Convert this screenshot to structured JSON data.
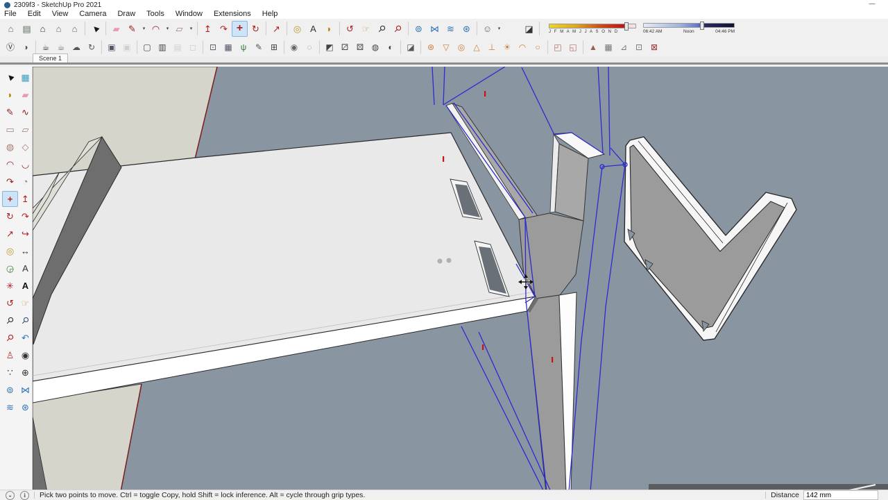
{
  "window": {
    "title": "2309f3 - SketchUp Pro 2021",
    "minimize_glyph": "—"
  },
  "menu": {
    "items": [
      "File",
      "Edit",
      "View",
      "Camera",
      "Draw",
      "Tools",
      "Window",
      "Extensions",
      "Help"
    ]
  },
  "toolbar_top": {
    "icons": [
      {
        "n": "view-house-iso-icon",
        "g": "⌂",
        "c": "#5f6e5f"
      },
      {
        "n": "view-box-icon",
        "g": "▤",
        "c": "#5f6e5f"
      },
      {
        "n": "view-home-icon",
        "g": "⌂",
        "c": "#333333"
      },
      {
        "n": "view-house-front-icon",
        "g": "⌂",
        "c": "#5f6e5f"
      },
      {
        "n": "view-house-wide-icon",
        "g": "⌂",
        "c": "#5f6e5f"
      },
      {
        "t": "sep"
      },
      {
        "n": "select-tool-icon",
        "g": "►",
        "c": "#1a1a1a",
        "rot": -135
      },
      {
        "t": "sep"
      },
      {
        "n": "eraser-tool-icon",
        "g": "▰",
        "c": "#e89ab0"
      },
      {
        "n": "line-tool-icon",
        "g": "✎",
        "c": "#8b1a1a"
      },
      {
        "n": "line-dropdown-icon",
        "t": "dd",
        "g": "▾"
      },
      {
        "n": "arc-tool-icon",
        "g": "◠",
        "c": "#8b1a1a"
      },
      {
        "n": "arc-dropdown-icon",
        "t": "dd",
        "g": "▾"
      },
      {
        "n": "rectangle-tool-icon",
        "g": "▱",
        "c": "#a08074"
      },
      {
        "n": "rectangle-dropdown-icon",
        "t": "dd",
        "g": "▾"
      },
      {
        "t": "sep"
      },
      {
        "n": "push-pull-tool-icon",
        "g": "↥",
        "c": "#b02020"
      },
      {
        "n": "follow-me-tool-icon",
        "g": "↷",
        "c": "#b02020"
      },
      {
        "n": "move-tool-icon",
        "g": "+",
        "c": "#b02020",
        "sel": true,
        "b": true
      },
      {
        "n": "rotate-tool-icon",
        "g": "↻",
        "c": "#b02020"
      },
      {
        "t": "sep"
      },
      {
        "n": "scale-tool-icon",
        "g": "↗",
        "c": "#b02020"
      },
      {
        "t": "sep"
      },
      {
        "n": "tape-measure-icon",
        "g": "◎",
        "c": "#b8962e"
      },
      {
        "n": "text-tool-icon",
        "g": "A",
        "c": "#333333"
      },
      {
        "n": "paint-bucket-icon",
        "g": "◗",
        "c": "#b8860b"
      },
      {
        "t": "sep"
      },
      {
        "n": "orbit-tool-icon",
        "g": "↺",
        "c": "#b02020"
      },
      {
        "n": "pan-tool-icon",
        "g": "☞",
        "c": "#c8a050"
      },
      {
        "n": "zoom-tool-icon",
        "g": "⚲",
        "c": "#333333",
        "rot": 45
      },
      {
        "n": "zoom-extents-icon",
        "g": "⚲",
        "c": "#b02020",
        "rot": 45
      },
      {
        "t": "sep"
      },
      {
        "n": "scan-essentials-icon",
        "g": "⊚",
        "c": "#2f74b5"
      },
      {
        "n": "trimble-scan-icon",
        "g": "⋈",
        "c": "#2f74b5"
      },
      {
        "n": "layers-blue-icon",
        "g": "≋",
        "c": "#2f74b5"
      },
      {
        "n": "mesh-blue-icon",
        "g": "⊛",
        "c": "#2f74b5"
      },
      {
        "t": "sep"
      },
      {
        "n": "account-icon",
        "g": "☺",
        "c": "#666666"
      },
      {
        "n": "account-dropdown-icon",
        "t": "dd",
        "g": "▾"
      },
      {
        "t": "gap"
      },
      {
        "n": "shadows-toggle-icon",
        "g": "◪",
        "c": "#333333"
      },
      {
        "t": "sep"
      }
    ]
  },
  "shadow_bar": {
    "months": "J F M A M J J A S O N D",
    "time_start": "06:42 AM",
    "time_mid": "Noon",
    "time_end": "04:46 PM",
    "date_stops": [
      "#ead823 0%",
      "#e0a81e 30%",
      "#cc4418 62%",
      "#c01616 87%",
      "#f0d9d9 88%",
      "#f3e4e4 100%"
    ],
    "time_stops": [
      "#e4ebf4 0%",
      "#9fb4dd 40%",
      "#6474cc 60%",
      "#262a66 68%",
      "#10122e 100%"
    ]
  },
  "toolbar_vray": {
    "icons": [
      {
        "n": "vray-logo-icon",
        "g": "Ⓥ",
        "c": "#3a3a3a"
      },
      {
        "n": "asset-editor-icon",
        "g": "◑",
        "c": "#555555"
      },
      {
        "t": "sep"
      },
      {
        "n": "render-icon",
        "g": "☕",
        "c": "#3a3a3a"
      },
      {
        "n": "interactive-render-icon",
        "g": "☕",
        "c": "#777777"
      },
      {
        "n": "cloud-render-icon",
        "g": "☁",
        "c": "#555555"
      },
      {
        "n": "swarm-render-icon",
        "g": "↻",
        "c": "#555555"
      },
      {
        "t": "sep"
      },
      {
        "n": "viewport-render-icon",
        "g": "▣",
        "c": "#555566"
      },
      {
        "n": "viewport-render-region-icon",
        "g": "▣",
        "c": "#b5b5b5",
        "dis": true
      },
      {
        "t": "sep"
      },
      {
        "n": "frame-buffer-icon",
        "g": "▢",
        "c": "#444444"
      },
      {
        "n": "batch-render-icon",
        "g": "▥",
        "c": "#444444"
      },
      {
        "n": "image-viewer-icon",
        "g": "▤",
        "c": "#b5b5b5",
        "dis": true
      },
      {
        "n": "lock-icon",
        "g": "◻",
        "c": "#b5b5b5",
        "dis": true
      },
      {
        "t": "sep"
      },
      {
        "n": "infinite-plane-icon",
        "g": "⊡",
        "c": "#555566"
      },
      {
        "n": "displacement-icon",
        "g": "▦",
        "c": "#555566"
      },
      {
        "n": "fur-icon",
        "g": "ψ",
        "c": "#3a7a3a"
      },
      {
        "n": "clipper-icon",
        "g": "✎",
        "c": "#555555"
      },
      {
        "n": "vray-mesh-icon",
        "g": "⊞",
        "c": "#444444"
      },
      {
        "t": "sep"
      },
      {
        "n": "sphere-add-icon",
        "g": "◉",
        "c": "#666666"
      },
      {
        "n": "sphere-remove-icon",
        "g": "◌",
        "c": "#888888"
      },
      {
        "t": "sep"
      },
      {
        "n": "material-id-icon",
        "g": "◩",
        "c": "#444444"
      },
      {
        "n": "random-color-icon",
        "g": "⚂",
        "c": "#444444"
      },
      {
        "n": "multimatte-icon",
        "g": "⚄",
        "c": "#444444"
      },
      {
        "n": "checker-sphere-icon",
        "g": "◍",
        "c": "#444444"
      },
      {
        "n": "half-sphere-icon",
        "g": "◐",
        "c": "#444444"
      },
      {
        "t": "sep"
      },
      {
        "n": "cube-pick-icon",
        "g": "◪",
        "c": "#555555"
      },
      {
        "t": "sep"
      },
      {
        "n": "light-gen-icon",
        "g": "⊛",
        "c": "#c87f3e"
      },
      {
        "n": "spot-light-icon",
        "g": "▽",
        "c": "#c87f3e"
      },
      {
        "n": "omni-light-icon",
        "g": "◎",
        "c": "#c87f3e"
      },
      {
        "n": "directional-light-icon",
        "g": "△",
        "c": "#c87f3e"
      },
      {
        "n": "ies-light-icon",
        "g": "⊥",
        "c": "#c87f3e"
      },
      {
        "n": "sun-light-icon",
        "g": "☀",
        "c": "#c87f3e"
      },
      {
        "n": "dome-light-icon",
        "g": "◠",
        "c": "#c87f3e"
      },
      {
        "n": "sphere-light-icon",
        "g": "○",
        "c": "#c87f3e"
      },
      {
        "t": "sep"
      },
      {
        "n": "proxy-import-icon",
        "g": "◰",
        "c": "#b06a6a"
      },
      {
        "n": "proxy-export-icon",
        "g": "◱",
        "c": "#b06a6a"
      },
      {
        "t": "sep"
      },
      {
        "n": "sandbox-from-contours-icon",
        "g": "▲",
        "c": "#96604e"
      },
      {
        "n": "sandbox-from-scratch-icon",
        "g": "▦",
        "c": "#777777"
      },
      {
        "n": "smoove-icon",
        "g": "⊿",
        "c": "#777777"
      },
      {
        "n": "stamp-icon",
        "g": "⊡",
        "c": "#777777"
      },
      {
        "n": "flip-edge-icon",
        "g": "⊠",
        "c": "#a03333"
      }
    ]
  },
  "left_toolbar": {
    "icons": [
      {
        "n": "select-tool-icon",
        "g": "►",
        "c": "#111111",
        "rot": -135
      },
      {
        "n": "make-component-icon",
        "g": "▦",
        "c": "#3aa0c0"
      },
      {
        "n": "paint-bucket-icon",
        "g": "◗",
        "c": "#b8860b"
      },
      {
        "n": "eraser-tool-icon",
        "g": "▰",
        "c": "#e89ab0"
      },
      {
        "n": "line-tool-icon",
        "g": "✎",
        "c": "#8b1a1a"
      },
      {
        "n": "freehand-tool-icon",
        "g": "∿",
        "c": "#8b1a1a"
      },
      {
        "n": "rectangle-tool-icon",
        "g": "▭",
        "c": "#a08074"
      },
      {
        "n": "rotated-rectangle-icon",
        "g": "▱",
        "c": "#a08074"
      },
      {
        "n": "circle-tool-icon",
        "g": "◍",
        "c": "#a08074"
      },
      {
        "n": "polygon-tool-icon",
        "g": "◇",
        "c": "#a08074"
      },
      {
        "n": "arc-tool-icon",
        "g": "◠",
        "c": "#8b1a1a"
      },
      {
        "n": "two-point-arc-icon",
        "g": "◡",
        "c": "#8b1a1a"
      },
      {
        "n": "three-point-arc-icon",
        "g": "↷",
        "c": "#8b1a1a"
      },
      {
        "n": "pie-tool-icon",
        "g": "◔",
        "c": "#a08074"
      },
      {
        "n": "move-tool-icon",
        "g": "+",
        "c": "#b02020",
        "sel": true,
        "b": true
      },
      {
        "n": "push-pull-tool-icon",
        "g": "↥",
        "c": "#b02020"
      },
      {
        "n": "rotate-tool-icon",
        "g": "↻",
        "c": "#b02020"
      },
      {
        "n": "follow-me-tool-icon",
        "g": "↷",
        "c": "#b02020"
      },
      {
        "n": "scale-tool-icon",
        "g": "↗",
        "c": "#b02020"
      },
      {
        "n": "offset-tool-icon",
        "g": "↪",
        "c": "#b02020"
      },
      {
        "n": "tape-measure-icon",
        "g": "◎",
        "c": "#b8962e"
      },
      {
        "n": "dimension-tool-icon",
        "g": "↔",
        "c": "#333333"
      },
      {
        "n": "protractor-tool-icon",
        "g": "◶",
        "c": "#3a7d3a"
      },
      {
        "n": "text-tool-icon",
        "g": "A",
        "c": "#333333"
      },
      {
        "n": "axes-tool-icon",
        "g": "✳",
        "c": "#b02020"
      },
      {
        "n": "3d-text-icon",
        "g": "A",
        "c": "#111111",
        "b": true
      },
      {
        "n": "orbit-tool-icon",
        "g": "↺",
        "c": "#b02020"
      },
      {
        "n": "pan-tool-icon",
        "g": "☞",
        "c": "#c8a050"
      },
      {
        "n": "zoom-tool-icon",
        "g": "⚲",
        "c": "#333333",
        "rot": 45
      },
      {
        "n": "zoom-window-icon",
        "g": "⚲",
        "c": "#335577",
        "rot": 45
      },
      {
        "n": "zoom-extents-icon",
        "g": "⚲",
        "c": "#b02020",
        "rot": 45
      },
      {
        "n": "previous-view-icon",
        "g": "↶",
        "c": "#2f74b5"
      },
      {
        "n": "position-camera-icon",
        "g": "♙",
        "c": "#b03333"
      },
      {
        "n": "look-around-icon",
        "g": "◉",
        "c": "#333333"
      },
      {
        "n": "walk-tool-icon",
        "g": "∵",
        "c": "#333333"
      },
      {
        "n": "section-plane-icon",
        "g": "⊕",
        "c": "#333333"
      },
      {
        "n": "scan-essentials-icon",
        "g": "⊚",
        "c": "#2f74b5"
      },
      {
        "n": "trimble-scan-icon",
        "g": "⋈",
        "c": "#2f74b5"
      },
      {
        "n": "layers-blue-icon",
        "g": "≋",
        "c": "#2f74b5"
      },
      {
        "n": "mesh-blue-icon",
        "g": "⊛",
        "c": "#2f74b5"
      }
    ]
  },
  "scene_tabs": {
    "active_tab": "Scene 1"
  },
  "viewport": {
    "colors": {
      "bg": "#8a95a2",
      "board_top": "#e9e9e9",
      "board_front": "#ffffff",
      "edge_dark": "#6e6e6e",
      "beige": "#d6d5cb",
      "ridge_light": "#dfdfd8",
      "gray_face": "#9b9b9b",
      "gray_arm": "#a8a8a8",
      "slot": "#6a7078",
      "selection": "#2b2bd0",
      "red_edge": "#7a2424",
      "tick_red": "#cc1111",
      "dot_gray": "#b0b0b0",
      "dark_band": "#5a5d61"
    },
    "cursor": "move"
  },
  "status_bar": {
    "hint": "Pick two points to move.  Ctrl = toggle Copy, hold Shift = lock inference. Alt = cycle through grip types.",
    "measure_label": "Distance",
    "measure_value": "142 mm"
  }
}
